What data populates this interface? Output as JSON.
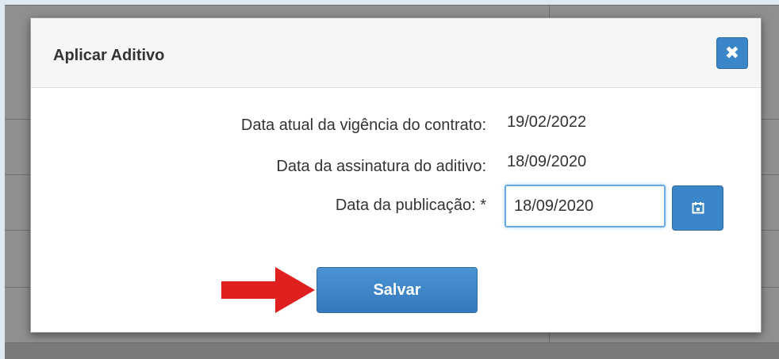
{
  "dialog": {
    "title": "Aplicar Aditivo",
    "close_icon": "close-icon"
  },
  "fields": {
    "contract_validity_label": "Data atual da vigência do contrato:",
    "contract_validity_value": "19/02/2022",
    "signature_label": "Data da assinatura do aditivo:",
    "signature_value": "18/09/2020",
    "publication_label": "Data da publicação: *",
    "publication_value": "18/09/2020",
    "calendar_icon": "calendar-icon"
  },
  "actions": {
    "save_label": "Salvar",
    "arrow_icon": "red-arrow-icon"
  },
  "colors": {
    "accent": "#3b86c8",
    "arrow": "#e01f1f"
  }
}
